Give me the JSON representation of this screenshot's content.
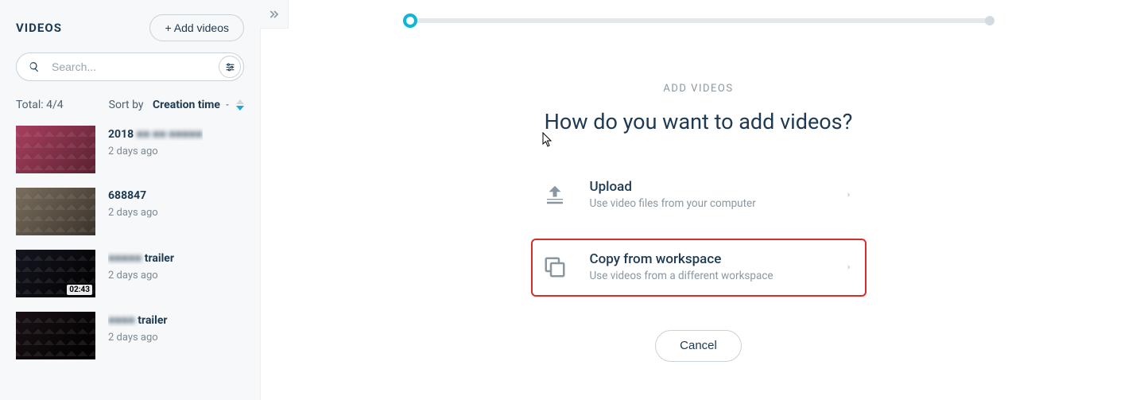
{
  "sidebar": {
    "title": "VIDEOS",
    "add_button": "+ Add videos",
    "search_placeholder": "Search...",
    "total_label": "Total: 4/4",
    "sort_label": "Sort by",
    "sort_value": "Creation time",
    "items": [
      {
        "title_prefix": "2018 ",
        "title_blur": "■■ ■■ ■■■■■",
        "date": "2 days ago",
        "timestamp": ""
      },
      {
        "title_prefix": "688847",
        "title_blur": "",
        "date": "2 days ago",
        "timestamp": ""
      },
      {
        "title_prefix": "",
        "title_blur": "■■■■■",
        "title_suffix": " trailer",
        "date": "2 days ago",
        "timestamp": "02:43"
      },
      {
        "title_prefix": "",
        "title_blur": "■■■■",
        "title_suffix": " trailer",
        "date": "2 days ago",
        "timestamp": ""
      }
    ]
  },
  "main": {
    "eyebrow": "ADD VIDEOS",
    "headline": "How do you want to add videos?",
    "options": [
      {
        "title": "Upload",
        "subtitle": "Use video files from your computer"
      },
      {
        "title": "Copy from workspace",
        "subtitle": "Use videos from a different workspace"
      }
    ],
    "cancel": "Cancel"
  }
}
